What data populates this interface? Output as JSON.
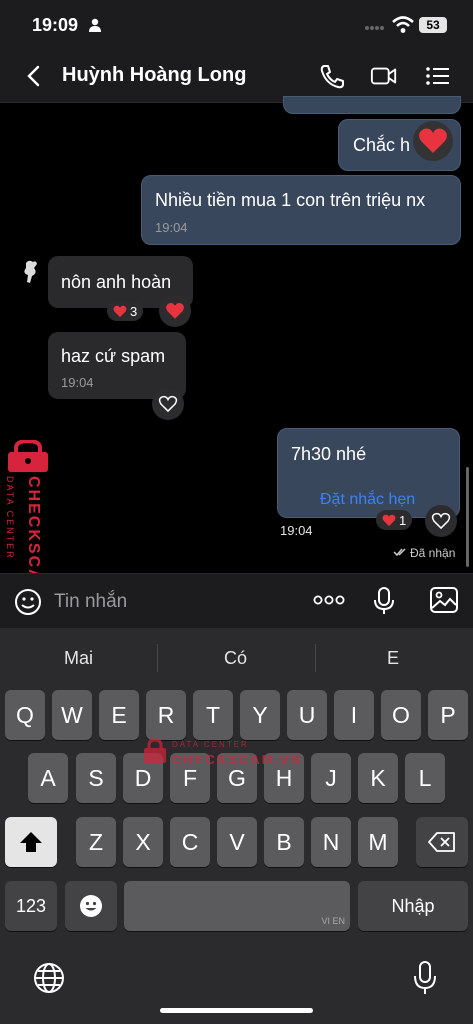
{
  "status_bar": {
    "time": "19:09",
    "battery": "53"
  },
  "header": {
    "contact_name": "Huỳnh Hoàng Long"
  },
  "messages": {
    "m1_text": "Chắc h",
    "m2_text": "Nhiều tiền mua 1 con trên triệu nx",
    "m2_time": "19:04",
    "m3_text": "nôn anh hoàn",
    "m3_react_count": "3",
    "m4_text": "haz cứ spam",
    "m4_time": "19:04",
    "m5_text": "7h30 nhé",
    "m5_action": "Đặt nhắc hẹn",
    "m5_time": "19:04",
    "m5_react_count": "1",
    "seen": "Đã nhận"
  },
  "input": {
    "placeholder": "Tin nhắn"
  },
  "keyboard": {
    "suggestions": [
      "Mai",
      "Có",
      "E"
    ],
    "row1": [
      "Q",
      "W",
      "E",
      "R",
      "T",
      "Y",
      "U",
      "I",
      "O",
      "P"
    ],
    "row2": [
      "A",
      "S",
      "D",
      "F",
      "G",
      "H",
      "J",
      "K",
      "L"
    ],
    "row3": [
      "Z",
      "X",
      "C",
      "V",
      "B",
      "N",
      "M"
    ],
    "numbers_key": "123",
    "space_hint": "VI EN",
    "return_key": "Nhập"
  },
  "watermark": {
    "text": "CHECKSCAM.VN",
    "sub": "DATA CENTER"
  },
  "colors": {
    "accent_heart": "#e8343f",
    "bubble_out": "#38475c",
    "link": "#3b82f6"
  }
}
